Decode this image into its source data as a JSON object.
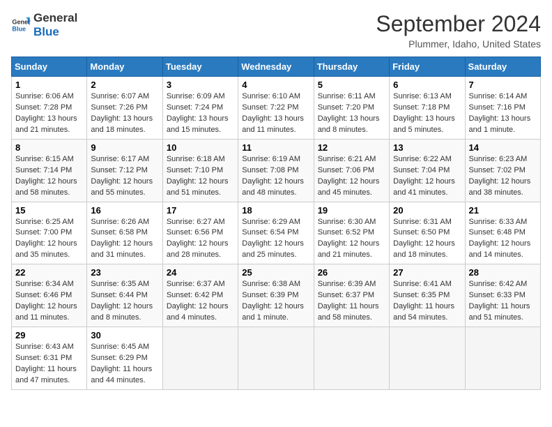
{
  "header": {
    "logo_line1": "General",
    "logo_line2": "Blue",
    "month_title": "September 2024",
    "location": "Plummer, Idaho, United States"
  },
  "days_of_week": [
    "Sunday",
    "Monday",
    "Tuesday",
    "Wednesday",
    "Thursday",
    "Friday",
    "Saturday"
  ],
  "weeks": [
    [
      {
        "num": "1",
        "sunrise": "Sunrise: 6:06 AM",
        "sunset": "Sunset: 7:28 PM",
        "daylight": "Daylight: 13 hours and 21 minutes."
      },
      {
        "num": "2",
        "sunrise": "Sunrise: 6:07 AM",
        "sunset": "Sunset: 7:26 PM",
        "daylight": "Daylight: 13 hours and 18 minutes."
      },
      {
        "num": "3",
        "sunrise": "Sunrise: 6:09 AM",
        "sunset": "Sunset: 7:24 PM",
        "daylight": "Daylight: 13 hours and 15 minutes."
      },
      {
        "num": "4",
        "sunrise": "Sunrise: 6:10 AM",
        "sunset": "Sunset: 7:22 PM",
        "daylight": "Daylight: 13 hours and 11 minutes."
      },
      {
        "num": "5",
        "sunrise": "Sunrise: 6:11 AM",
        "sunset": "Sunset: 7:20 PM",
        "daylight": "Daylight: 13 hours and 8 minutes."
      },
      {
        "num": "6",
        "sunrise": "Sunrise: 6:13 AM",
        "sunset": "Sunset: 7:18 PM",
        "daylight": "Daylight: 13 hours and 5 minutes."
      },
      {
        "num": "7",
        "sunrise": "Sunrise: 6:14 AM",
        "sunset": "Sunset: 7:16 PM",
        "daylight": "Daylight: 13 hours and 1 minute."
      }
    ],
    [
      {
        "num": "8",
        "sunrise": "Sunrise: 6:15 AM",
        "sunset": "Sunset: 7:14 PM",
        "daylight": "Daylight: 12 hours and 58 minutes."
      },
      {
        "num": "9",
        "sunrise": "Sunrise: 6:17 AM",
        "sunset": "Sunset: 7:12 PM",
        "daylight": "Daylight: 12 hours and 55 minutes."
      },
      {
        "num": "10",
        "sunrise": "Sunrise: 6:18 AM",
        "sunset": "Sunset: 7:10 PM",
        "daylight": "Daylight: 12 hours and 51 minutes."
      },
      {
        "num": "11",
        "sunrise": "Sunrise: 6:19 AM",
        "sunset": "Sunset: 7:08 PM",
        "daylight": "Daylight: 12 hours and 48 minutes."
      },
      {
        "num": "12",
        "sunrise": "Sunrise: 6:21 AM",
        "sunset": "Sunset: 7:06 PM",
        "daylight": "Daylight: 12 hours and 45 minutes."
      },
      {
        "num": "13",
        "sunrise": "Sunrise: 6:22 AM",
        "sunset": "Sunset: 7:04 PM",
        "daylight": "Daylight: 12 hours and 41 minutes."
      },
      {
        "num": "14",
        "sunrise": "Sunrise: 6:23 AM",
        "sunset": "Sunset: 7:02 PM",
        "daylight": "Daylight: 12 hours and 38 minutes."
      }
    ],
    [
      {
        "num": "15",
        "sunrise": "Sunrise: 6:25 AM",
        "sunset": "Sunset: 7:00 PM",
        "daylight": "Daylight: 12 hours and 35 minutes."
      },
      {
        "num": "16",
        "sunrise": "Sunrise: 6:26 AM",
        "sunset": "Sunset: 6:58 PM",
        "daylight": "Daylight: 12 hours and 31 minutes."
      },
      {
        "num": "17",
        "sunrise": "Sunrise: 6:27 AM",
        "sunset": "Sunset: 6:56 PM",
        "daylight": "Daylight: 12 hours and 28 minutes."
      },
      {
        "num": "18",
        "sunrise": "Sunrise: 6:29 AM",
        "sunset": "Sunset: 6:54 PM",
        "daylight": "Daylight: 12 hours and 25 minutes."
      },
      {
        "num": "19",
        "sunrise": "Sunrise: 6:30 AM",
        "sunset": "Sunset: 6:52 PM",
        "daylight": "Daylight: 12 hours and 21 minutes."
      },
      {
        "num": "20",
        "sunrise": "Sunrise: 6:31 AM",
        "sunset": "Sunset: 6:50 PM",
        "daylight": "Daylight: 12 hours and 18 minutes."
      },
      {
        "num": "21",
        "sunrise": "Sunrise: 6:33 AM",
        "sunset": "Sunset: 6:48 PM",
        "daylight": "Daylight: 12 hours and 14 minutes."
      }
    ],
    [
      {
        "num": "22",
        "sunrise": "Sunrise: 6:34 AM",
        "sunset": "Sunset: 6:46 PM",
        "daylight": "Daylight: 12 hours and 11 minutes."
      },
      {
        "num": "23",
        "sunrise": "Sunrise: 6:35 AM",
        "sunset": "Sunset: 6:44 PM",
        "daylight": "Daylight: 12 hours and 8 minutes."
      },
      {
        "num": "24",
        "sunrise": "Sunrise: 6:37 AM",
        "sunset": "Sunset: 6:42 PM",
        "daylight": "Daylight: 12 hours and 4 minutes."
      },
      {
        "num": "25",
        "sunrise": "Sunrise: 6:38 AM",
        "sunset": "Sunset: 6:39 PM",
        "daylight": "Daylight: 12 hours and 1 minute."
      },
      {
        "num": "26",
        "sunrise": "Sunrise: 6:39 AM",
        "sunset": "Sunset: 6:37 PM",
        "daylight": "Daylight: 11 hours and 58 minutes."
      },
      {
        "num": "27",
        "sunrise": "Sunrise: 6:41 AM",
        "sunset": "Sunset: 6:35 PM",
        "daylight": "Daylight: 11 hours and 54 minutes."
      },
      {
        "num": "28",
        "sunrise": "Sunrise: 6:42 AM",
        "sunset": "Sunset: 6:33 PM",
        "daylight": "Daylight: 11 hours and 51 minutes."
      }
    ],
    [
      {
        "num": "29",
        "sunrise": "Sunrise: 6:43 AM",
        "sunset": "Sunset: 6:31 PM",
        "daylight": "Daylight: 11 hours and 47 minutes."
      },
      {
        "num": "30",
        "sunrise": "Sunrise: 6:45 AM",
        "sunset": "Sunset: 6:29 PM",
        "daylight": "Daylight: 11 hours and 44 minutes."
      },
      null,
      null,
      null,
      null,
      null
    ]
  ]
}
